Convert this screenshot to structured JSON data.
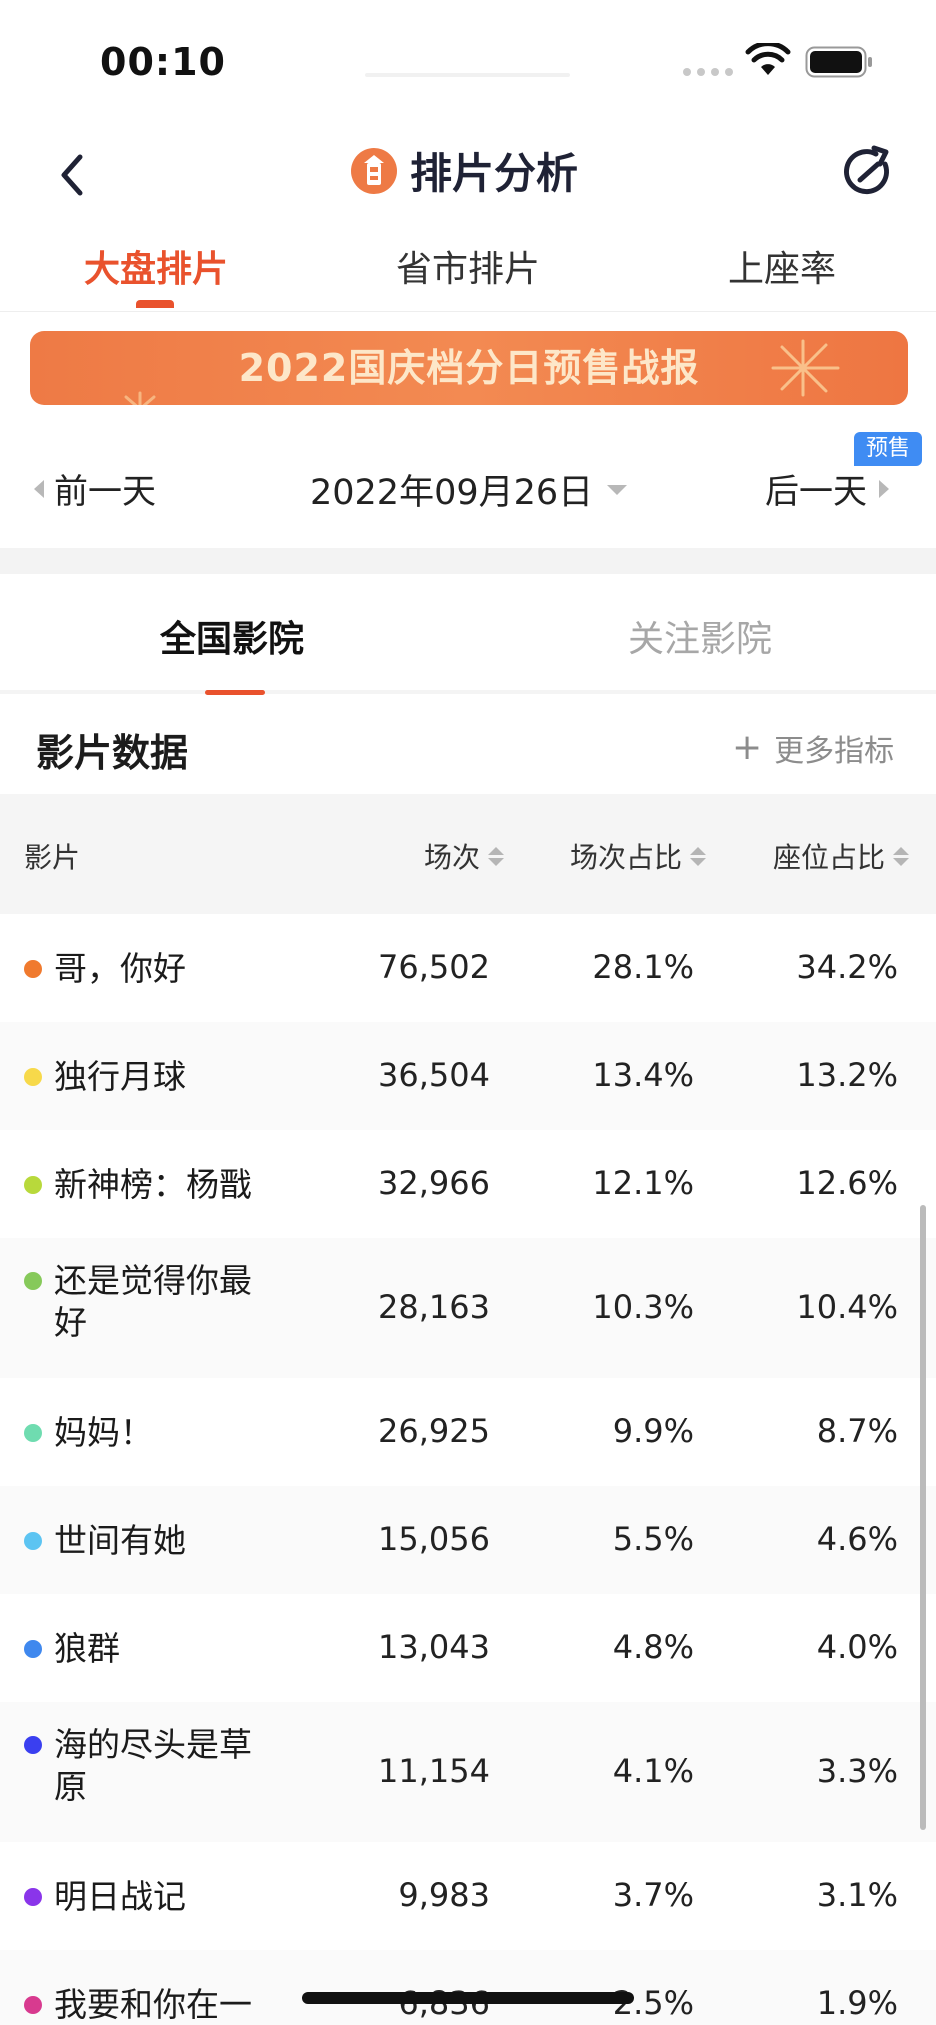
{
  "status_bar": {
    "time": "00:10"
  },
  "nav": {
    "title": "排片分析"
  },
  "top_tabs": [
    "大盘排片",
    "省市排片",
    "上座率"
  ],
  "banner": {
    "text": "2022国庆档分日预售战报"
  },
  "date_nav": {
    "prev": "前一天",
    "current": "2022年09月26日",
    "next": "后一天",
    "badge": "预售"
  },
  "cinema_tabs": [
    "全国影院",
    "关注影院"
  ],
  "section": {
    "title": "影片数据",
    "more": "更多指标"
  },
  "table": {
    "headers": [
      "影片",
      "场次",
      "场次占比",
      "座位占比"
    ],
    "rows": [
      {
        "name": "哥，你好",
        "shows": "76,502",
        "show_ratio": "28.1%",
        "seat_ratio": "34.2%",
        "color": "#f07a2e"
      },
      {
        "name": "独行月球",
        "shows": "36,504",
        "show_ratio": "13.4%",
        "seat_ratio": "13.2%",
        "color": "#f7d94a"
      },
      {
        "name": "新神榜：杨戬",
        "shows": "32,966",
        "show_ratio": "12.1%",
        "seat_ratio": "12.6%",
        "color": "#b8d93b"
      },
      {
        "name": "还是觉得你最好",
        "shows": "28,163",
        "show_ratio": "10.3%",
        "seat_ratio": "10.4%",
        "color": "#86c95a"
      },
      {
        "name": "妈妈！",
        "shows": "26,925",
        "show_ratio": "9.9%",
        "seat_ratio": "8.7%",
        "color": "#6fdcb0"
      },
      {
        "name": "世间有她",
        "shows": "15,056",
        "show_ratio": "5.5%",
        "seat_ratio": "4.6%",
        "color": "#5cc4f2"
      },
      {
        "name": "狼群",
        "shows": "13,043",
        "show_ratio": "4.8%",
        "seat_ratio": "4.0%",
        "color": "#3f88ee"
      },
      {
        "name": "海的尽头是草原",
        "shows": "11,154",
        "show_ratio": "4.1%",
        "seat_ratio": "3.3%",
        "color": "#3a3ff0"
      },
      {
        "name": "明日战记",
        "shows": "9,983",
        "show_ratio": "3.7%",
        "seat_ratio": "3.1%",
        "color": "#8a35ea"
      },
      {
        "name": "我要和你在一",
        "shows": "6,836",
        "show_ratio": "2.5%",
        "seat_ratio": "1.9%",
        "color": "#d83a8f"
      }
    ]
  }
}
